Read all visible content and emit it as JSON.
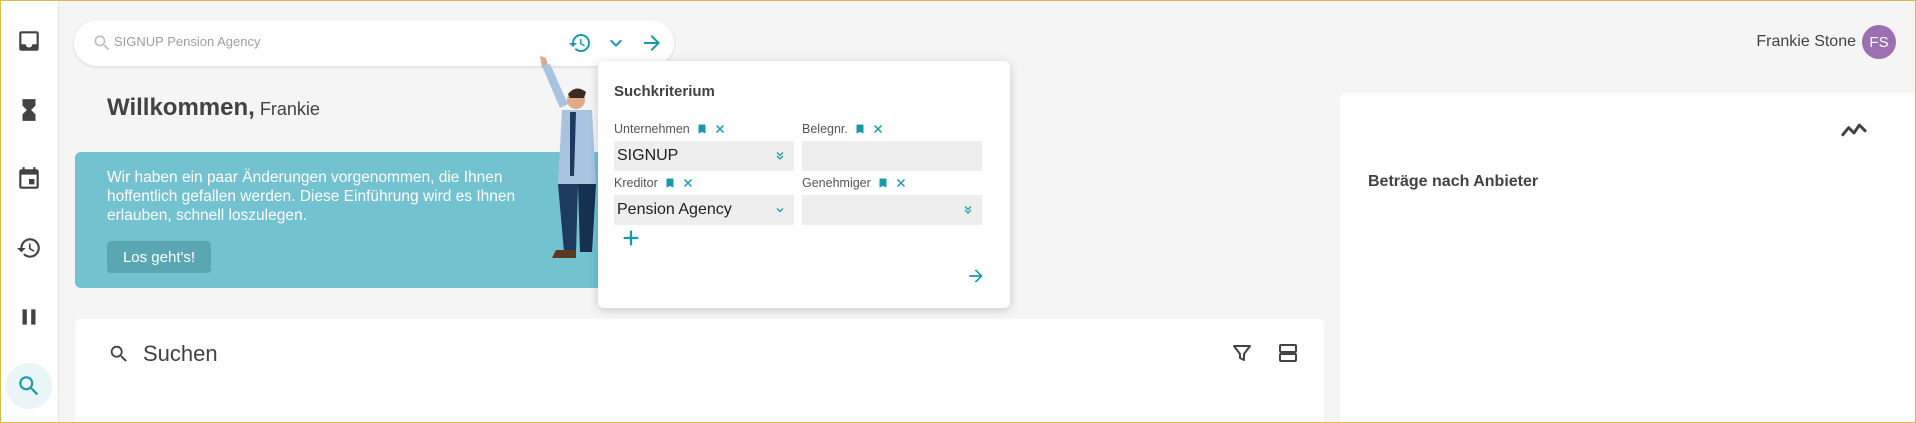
{
  "sidebar": {
    "items": [
      {
        "icon": "inbox-icon"
      },
      {
        "icon": "hourglass-icon"
      },
      {
        "icon": "calendar-icon"
      },
      {
        "icon": "history-icon"
      },
      {
        "icon": "pause-icon"
      },
      {
        "icon": "search-icon",
        "active": true
      }
    ]
  },
  "searchbar": {
    "text": "SIGNUP Pension Agency"
  },
  "user": {
    "name": "Frankie Stone",
    "initials": "FS"
  },
  "welcome": {
    "greeting": "Willkommen,",
    "name": "Frankie"
  },
  "banner": {
    "message": "Wir haben ein paar Änderungen vorgenommen, die Ihnen hoffentlich gefallen werden. Diese Einführung wird es Ihnen erlauben, schnell loszulegen.",
    "button": "Los geht's!"
  },
  "popup": {
    "title": "Suchkriterium",
    "fields": {
      "unternehmen": {
        "label": "Unternehmen",
        "value": "SIGNUP"
      },
      "belegnr": {
        "label": "Belegnr.",
        "value": ""
      },
      "kreditor": {
        "label": "Kreditor",
        "value": "Pension Agency"
      },
      "genehmiger": {
        "label": "Genehmiger",
        "value": ""
      }
    }
  },
  "search_card": {
    "title": "Suchen"
  },
  "right_card": {
    "title": "Beträge nach Anbieter"
  },
  "colors": {
    "accent": "#1a9aa8",
    "banner": "#72c2cf",
    "avatar": "#9b6fb0"
  }
}
